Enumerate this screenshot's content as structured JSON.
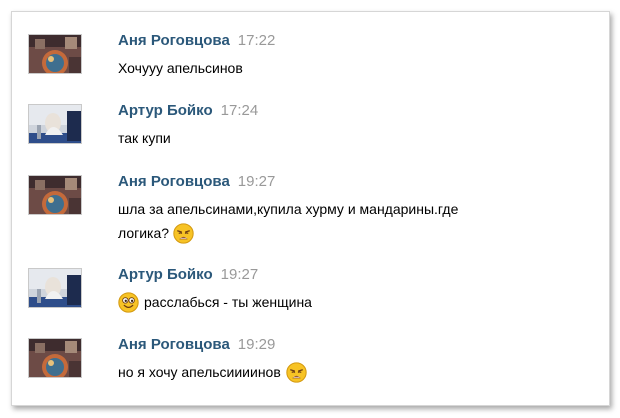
{
  "messages": [
    {
      "author": "Аня Роговцова",
      "time": "17:22",
      "text": "Хочууу апельсинов",
      "avatar": "anya-avatar"
    },
    {
      "author": "Артур Бойко",
      "time": "17:24",
      "text": "так купи",
      "avatar": "artur-avatar"
    },
    {
      "author": "Аня Роговцова",
      "time": "19:27",
      "text_line1": "шла за апельсинами,купила хурму и мандарины.где",
      "text_line2": "логика?",
      "emoji": "weary-face-icon",
      "avatar": "anya-avatar"
    },
    {
      "author": "Артур Бойко",
      "time": "19:27",
      "text": "расслабься - ты женщина",
      "emoji": "smiling-face-icon",
      "avatar": "artur-avatar"
    },
    {
      "author": "Аня Роговцова",
      "time": "19:29",
      "text": "но я хочу апельсиииинов",
      "emoji": "weary-face-icon",
      "avatar": "anya-avatar"
    }
  ],
  "colors": {
    "author": "#2b587a",
    "time": "#999999",
    "emoji": "#f7c325"
  }
}
